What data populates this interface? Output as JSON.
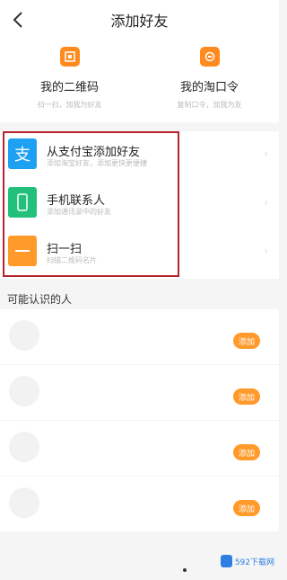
{
  "header": {
    "title": "添加好友"
  },
  "qr": {
    "left": {
      "label": "我的二维码",
      "sub": "扫一扫，加我为好友"
    },
    "right": {
      "label": "我的淘口令",
      "sub": "复制口令，加我为友"
    }
  },
  "list": [
    {
      "title": "从支付宝添加好友",
      "sub": "添加淘宝好友，添加更快更便捷",
      "icon": "支",
      "color": "#1ea1f2"
    },
    {
      "title": "手机联系人",
      "sub": "添加通讯录中的好友",
      "icon": "phone-icon",
      "color": "#22c07a"
    },
    {
      "title": "扫一扫",
      "sub": "扫描二维码名片",
      "icon": "scan-icon",
      "color": "#ff9a2b"
    }
  ],
  "people": {
    "title": "可能认识的人",
    "add_labels": [
      "添加",
      "添加",
      "添加",
      "添加"
    ]
  },
  "watermark": {
    "text": "592下载网"
  }
}
